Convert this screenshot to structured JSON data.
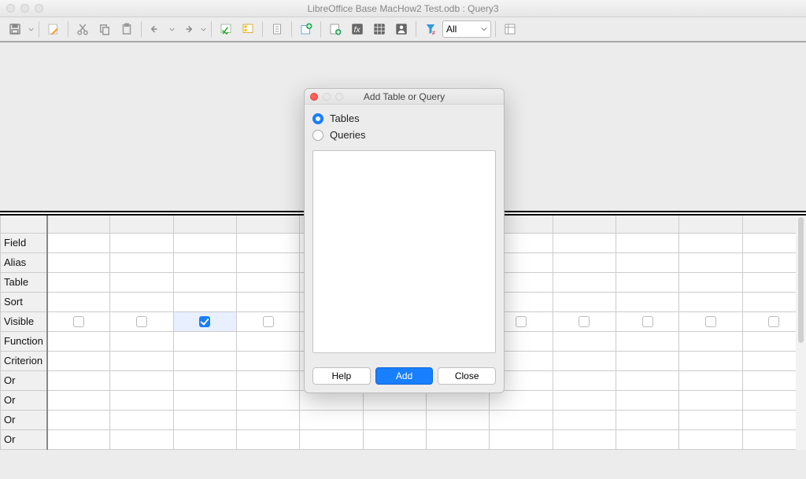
{
  "titlebar": {
    "title": "LibreOffice Base MacHow2 Test.odb : Query3"
  },
  "toolbar": {
    "filter_label": "All"
  },
  "grid": {
    "rows": [
      "Field",
      "Alias",
      "Table",
      "Sort",
      "Visible",
      "Function",
      "Criterion",
      "Or",
      "Or",
      "Or",
      "Or"
    ],
    "visible_checked_index": 2
  },
  "dialog": {
    "title": "Add Table or Query",
    "radio_tables": "Tables",
    "radio_queries": "Queries",
    "selected_radio": "tables",
    "help_label": "Help",
    "add_label": "Add",
    "close_label": "Close"
  }
}
